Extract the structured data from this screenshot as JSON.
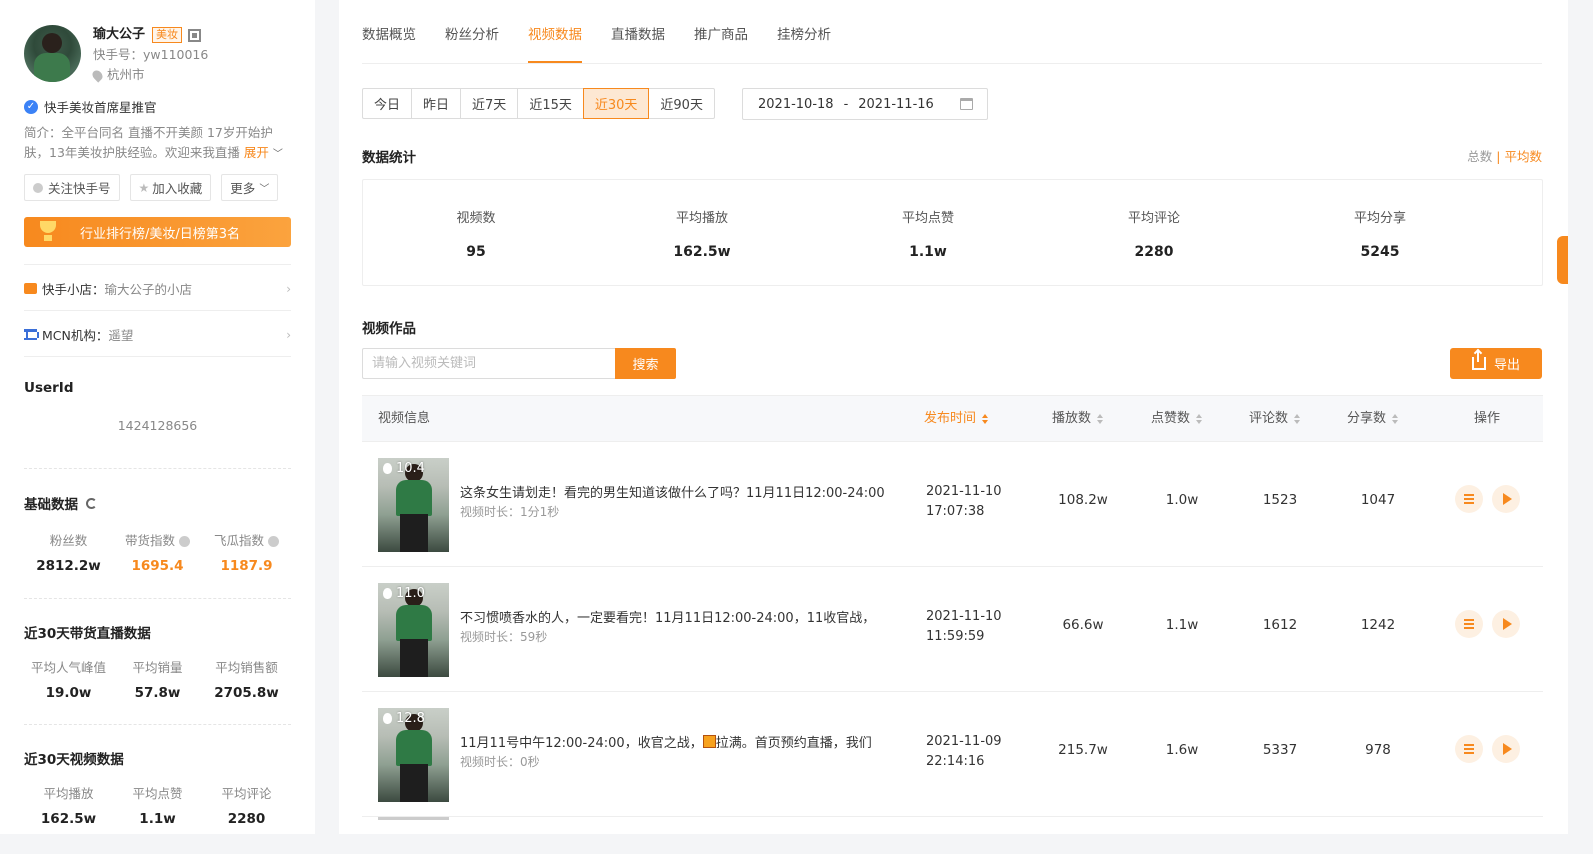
{
  "profile": {
    "name": "瑜大公子",
    "category_tag": "美妆",
    "kuaishou_id": "快手号：yw110016",
    "location": "杭州市",
    "verification": "快手美妆首席星推官",
    "intro": "简介：全平台同名 直播不开美颜 17岁开始护肤，13年美妆护肤经验。欢迎来我直播",
    "expand_label": "展开",
    "actions": {
      "follow": "关注快手号",
      "favorite": "加入收藏",
      "more": "更多"
    },
    "rank_banner": "行业排行榜/美妆/日榜第3名",
    "shop_label": "快手小店：",
    "shop_value": "瑜大公子的小店",
    "mcn_label": "MCN机构：",
    "mcn_value": "遥望",
    "userid_label": "UserId",
    "userid_value": "1424128656"
  },
  "basic_data": {
    "title": "基础数据",
    "stats": [
      {
        "label": "粉丝数",
        "value": "2812.2w"
      },
      {
        "label": "带货指数",
        "value": "1695.4"
      },
      {
        "label": "飞瓜指数",
        "value": "1187.9"
      }
    ]
  },
  "live_data_30": {
    "title": "近30天带货直播数据",
    "stats": [
      {
        "label": "平均人气峰值",
        "value": "19.0w"
      },
      {
        "label": "平均销量",
        "value": "57.8w"
      },
      {
        "label": "平均销售额",
        "value": "2705.8w"
      }
    ]
  },
  "video_data_30": {
    "title": "近30天视频数据",
    "stats": [
      {
        "label": "平均播放",
        "value": "162.5w"
      },
      {
        "label": "平均点赞",
        "value": "1.1w"
      },
      {
        "label": "平均评论",
        "value": "2280"
      }
    ]
  },
  "tabs": [
    "数据概览",
    "粉丝分析",
    "视频数据",
    "直播数据",
    "推广商品",
    "挂榜分析"
  ],
  "active_tab": "视频数据",
  "ranges": [
    "今日",
    "昨日",
    "近7天",
    "近15天",
    "近30天",
    "近90天"
  ],
  "active_range": "近30天",
  "date_range": {
    "start": "2021-10-18",
    "sep": "-",
    "end": "2021-11-16"
  },
  "stats_section": {
    "title": "数据统计",
    "toggle_total": "总数",
    "toggle_sep": "|",
    "toggle_avg": "平均数",
    "items": [
      {
        "label": "视频数",
        "value": "95"
      },
      {
        "label": "平均播放",
        "value": "162.5w"
      },
      {
        "label": "平均点赞",
        "value": "1.1w"
      },
      {
        "label": "平均评论",
        "value": "2280"
      },
      {
        "label": "平均分享",
        "value": "5245"
      }
    ]
  },
  "videos_section": {
    "title": "视频作品",
    "search_placeholder": "请输入视频关键词",
    "search_button": "搜索",
    "export_button": "导出",
    "columns": {
      "info": "视频信息",
      "publish": "发布时间",
      "plays": "播放数",
      "likes": "点赞数",
      "comments": "评论数",
      "shares": "分享数",
      "ops": "操作"
    },
    "rows": [
      {
        "score": "10.4",
        "title": "这条女生请划走！看完的男生知道该做什么了吗？11月11日12:00-24:00",
        "duration": "视频时长：1分1秒",
        "date": "2021-11-10",
        "time": "17:07:38",
        "plays": "108.2w",
        "likes": "1.0w",
        "comments": "1523",
        "shares": "1047"
      },
      {
        "score": "11.0",
        "title": "不习惯喷香水的人，一定要看完！11月11日12:00-24:00，11收官战，",
        "duration": "视频时长：59秒",
        "date": "2021-11-10",
        "time": "11:59:59",
        "plays": "66.6w",
        "likes": "1.1w",
        "comments": "1612",
        "shares": "1242"
      },
      {
        "score": "12.8",
        "title_a": "11月11号中午12:00-24:00，收官之战，",
        "title_b": "拉满。首页预约直播，我们",
        "duration": "视频时长：0秒",
        "date": "2021-11-09",
        "time": "22:14:16",
        "plays": "215.7w",
        "likes": "1.6w",
        "comments": "5337",
        "shares": "978"
      }
    ]
  },
  "colors": {
    "accent": "#f7891e",
    "verify": "#3b82f6"
  }
}
